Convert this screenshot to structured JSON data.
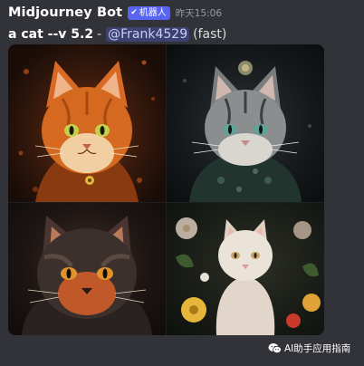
{
  "message": {
    "author": "Midjourney Bot",
    "bot_tag": "机器人",
    "bot_tag_icon": "checkmark-icon",
    "timestamp": "昨天15:06",
    "prompt": "a cat --v 5.2",
    "separator": "-",
    "mention": "@Frank4529",
    "mode": "(fast)"
  },
  "image_grid": {
    "tiles": [
      {
        "subject": "orange tabby cat portrait"
      },
      {
        "subject": "grey tabby cat in dark jacket with floral crown"
      },
      {
        "subject": "fluffy dark cat with orange eyes"
      },
      {
        "subject": "white cat sitting among flowers"
      }
    ]
  },
  "watermark": {
    "icon": "wechat-icon",
    "text": "AI助手应用指南"
  },
  "colors": {
    "background": "#313338",
    "author": "#ffffff",
    "bot_tag": "#5865f2",
    "timestamp": "#949ba4",
    "mention_bg": "#3c4270",
    "mention_text": "#c9cdfb"
  }
}
